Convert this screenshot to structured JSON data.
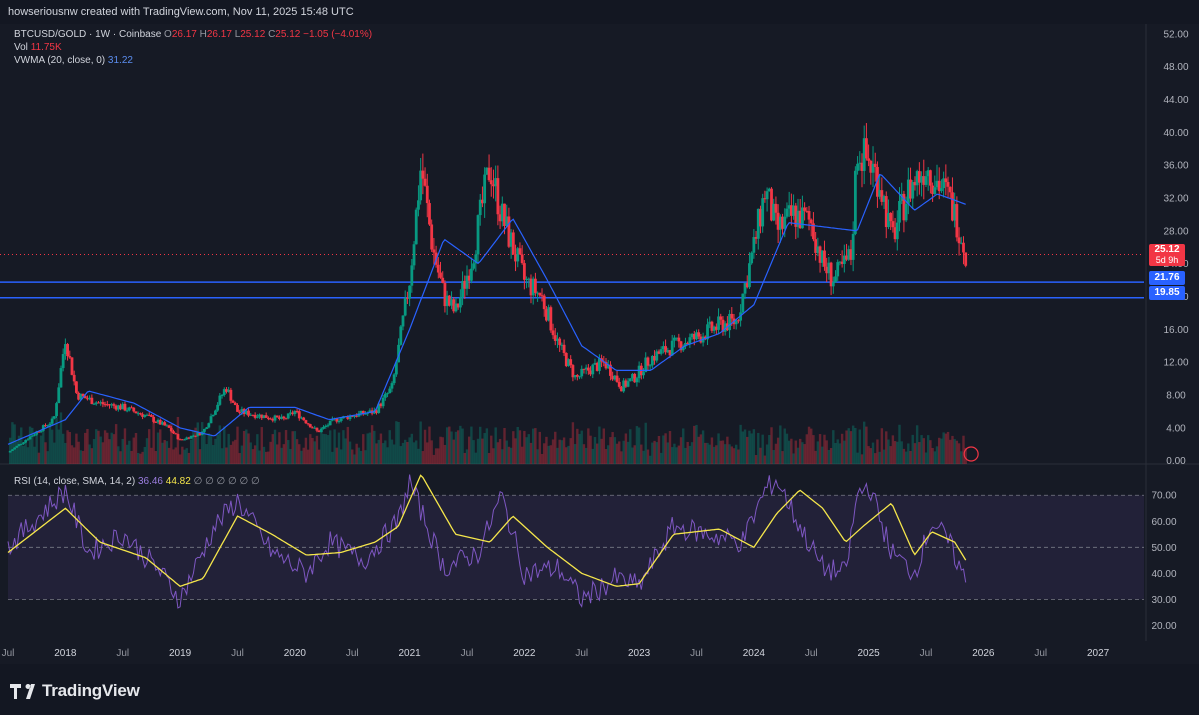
{
  "header": {
    "text": "howseriousnw created with TradingView.com, Nov 11, 2025 15:48 UTC"
  },
  "legend": {
    "symbol": "BTCUSD/GOLD · 1W · Coinbase",
    "open_label": "O",
    "open": "26.17",
    "high_label": "H",
    "high": "26.17",
    "low_label": "L",
    "low": "25.12",
    "close_label": "C",
    "close": "25.12",
    "change": "−1.05 (−4.01%)",
    "vol_label": "Vol",
    "vol": "11.75K",
    "vwma_label": "VWMA (20, close, 0)",
    "vwma": "31.22",
    "rsi_label": "RSI (14, close, SMA, 14, 2)",
    "rsi": "36.46",
    "rsi_ma": "44.82",
    "rsi_extra": "∅ ∅ ∅ ∅ ∅ ∅"
  },
  "tags": {
    "last_price": "25.12",
    "countdown": "5d 9h",
    "level_1": "21.76",
    "level_2": "19.85"
  },
  "footer": {
    "brand": "TradingView"
  },
  "colors": {
    "bg": "#161a25",
    "up": "#089981",
    "down": "#f23645",
    "vwma": "#2962ff",
    "rsi": "#7e57c2",
    "rsi_ma": "#f5e64b",
    "level": "#2962ff"
  },
  "chart_data": {
    "type": "candlestick",
    "price_axis": {
      "ticks": [
        "52.00",
        "48.00",
        "44.00",
        "40.00",
        "36.00",
        "32.00",
        "28.00",
        "24.00",
        "20.00",
        "16.00",
        "12.00",
        "8.00",
        "4.00",
        "0.00"
      ],
      "range": [
        -0.4,
        53.2
      ]
    },
    "rsi_axis": {
      "ticks": [
        "70.00",
        "60.00",
        "50.00",
        "40.00",
        "30.00",
        "20.00"
      ],
      "bands": [
        30,
        50,
        70
      ]
    },
    "time_axis": [
      "Jul",
      "2018",
      "Jul",
      "2019",
      "Jul",
      "2020",
      "Jul",
      "2021",
      "Jul",
      "2022",
      "Jul",
      "2023",
      "Jul",
      "2024",
      "Jul",
      "2025",
      "Jul",
      "2026",
      "Jul",
      "2027"
    ],
    "horizontal_levels": [
      21.76,
      19.85
    ],
    "series": [
      {
        "name": "BTCUSD/GOLD close",
        "x": [
          2017.5,
          2017.9,
          2018.0,
          2018.1,
          2018.3,
          2018.5,
          2018.7,
          2018.9,
          2019.0,
          2019.2,
          2019.4,
          2019.5,
          2019.7,
          2019.9,
          2020.0,
          2020.2,
          2020.35,
          2020.5,
          2020.7,
          2020.85,
          2021.0,
          2021.1,
          2021.2,
          2021.3,
          2021.4,
          2021.55,
          2021.7,
          2021.8,
          2021.9,
          2022.0,
          2022.15,
          2022.3,
          2022.45,
          2022.55,
          2022.7,
          2022.85,
          2022.95,
          2023.1,
          2023.3,
          2023.5,
          2023.7,
          2023.85,
          2024.0,
          2024.1,
          2024.2,
          2024.35,
          2024.5,
          2024.6,
          2024.7,
          2024.85,
          2024.9,
          2025.0,
          2025.1,
          2025.2,
          2025.35,
          2025.5,
          2025.6,
          2025.7,
          2025.8,
          2025.85
        ],
        "y": [
          1.0,
          5.0,
          15.0,
          8.0,
          7.0,
          6.5,
          5.5,
          4.0,
          2.5,
          3.5,
          9.0,
          6.0,
          5.5,
          5.0,
          6.0,
          3.5,
          5.0,
          5.5,
          6.0,
          9.0,
          22.0,
          36.0,
          26.0,
          20.0,
          18.0,
          25.0,
          36.0,
          30.0,
          26.0,
          22.0,
          20.0,
          14.0,
          10.0,
          11.0,
          12.0,
          9.0,
          10.0,
          12.5,
          14.0,
          15.0,
          16.5,
          17.0,
          26.0,
          33.0,
          28.0,
          30.0,
          29.0,
          24.0,
          22.0,
          25.0,
          38.0,
          36.5,
          34.0,
          27.0,
          33.0,
          36.0,
          34.0,
          32.0,
          28.0,
          25.12
        ]
      },
      {
        "name": "VWMA (20, close, 0)",
        "x": [
          2017.5,
          2018.0,
          2018.2,
          2018.6,
          2019.0,
          2019.3,
          2019.6,
          2020.0,
          2020.3,
          2020.7,
          2021.0,
          2021.3,
          2021.6,
          2021.9,
          2022.2,
          2022.5,
          2022.8,
          2023.1,
          2023.4,
          2023.7,
          2024.0,
          2024.3,
          2024.6,
          2024.9,
          2025.1,
          2025.4,
          2025.6,
          2025.85
        ],
        "y": [
          2.0,
          5.0,
          8.5,
          7.0,
          4.0,
          3.0,
          6.5,
          6.5,
          5.0,
          6.0,
          16.0,
          27.0,
          24.0,
          29.5,
          22.0,
          14.0,
          11.0,
          11.0,
          14.0,
          15.5,
          19.0,
          29.0,
          28.5,
          28.0,
          35.0,
          30.5,
          32.5,
          31.22
        ]
      },
      {
        "name": "RSI",
        "x": [
          2017.5,
          2018.0,
          2018.2,
          2018.5,
          2018.8,
          2019.0,
          2019.3,
          2019.5,
          2019.8,
          2020.1,
          2020.3,
          2020.6,
          2020.9,
          2021.0,
          2021.3,
          2021.6,
          2021.8,
          2022.0,
          2022.3,
          2022.5,
          2022.8,
          2023.0,
          2023.3,
          2023.6,
          2023.9,
          2024.1,
          2024.2,
          2024.4,
          2024.6,
          2024.8,
          2024.9,
          2025.0,
          2025.2,
          2025.4,
          2025.55,
          2025.7,
          2025.85
        ],
        "y": [
          50,
          72,
          48,
          55,
          42,
          30,
          58,
          68,
          48,
          40,
          52,
          45,
          60,
          75,
          42,
          48,
          70,
          40,
          42,
          30,
          38,
          35,
          58,
          55,
          52,
          72,
          76,
          58,
          42,
          40,
          70,
          74,
          48,
          40,
          60,
          52,
          36.46
        ]
      },
      {
        "name": "RSI SMA",
        "x": [
          2017.5,
          2018.0,
          2018.3,
          2018.7,
          2019.0,
          2019.2,
          2019.5,
          2019.8,
          2020.1,
          2020.4,
          2020.7,
          2020.9,
          2021.1,
          2021.4,
          2021.7,
          2021.9,
          2022.2,
          2022.5,
          2022.8,
          2023.0,
          2023.3,
          2023.7,
          2024.0,
          2024.2,
          2024.4,
          2024.6,
          2024.8,
          2024.95,
          2025.2,
          2025.4,
          2025.55,
          2025.75,
          2025.85
        ],
        "y": [
          48,
          65,
          52,
          46,
          35,
          38,
          62,
          55,
          47,
          48,
          52,
          58,
          78,
          55,
          52,
          62,
          50,
          40,
          35,
          36,
          55,
          57,
          50,
          63,
          72,
          65,
          52,
          58,
          67,
          47,
          56,
          52,
          44.82
        ]
      }
    ]
  }
}
